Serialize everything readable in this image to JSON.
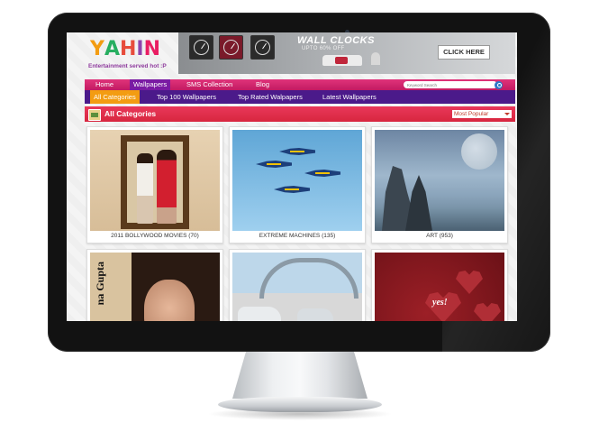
{
  "site": {
    "logo": {
      "letters": [
        "Y",
        "A",
        "H",
        "I",
        "N"
      ],
      "tagline": "Entertainment served hot :P"
    },
    "banner": {
      "title": "WALL CLOCKS",
      "subtitle": "UPTO 60% OFF",
      "cta": "CLICK HERE"
    },
    "nav_primary": [
      {
        "label": "Home"
      },
      {
        "label": "Wallpapers",
        "active": true
      },
      {
        "label": "SMS Collection"
      },
      {
        "label": "Blog"
      }
    ],
    "search": {
      "placeholder": "Keyword Search"
    },
    "nav_secondary": [
      {
        "label": "All Categories",
        "active": true
      },
      {
        "label": "Top 100 Wallpapers"
      },
      {
        "label": "Top Rated Walpapers"
      },
      {
        "label": "Latest Wallpapers"
      }
    ],
    "category_bar": {
      "title": "All Categories",
      "sort_selected": "Most Popular"
    },
    "categories": [
      {
        "caption": "2011 BOLLYWOOD MOVIES (70)"
      },
      {
        "caption": "EXTREME MACHINES (135)"
      },
      {
        "caption": "ART (953)"
      },
      {
        "caption": "",
        "overlay_text": "na Gupta"
      },
      {
        "caption": ""
      },
      {
        "caption": "",
        "overlay_text": "yes!"
      }
    ],
    "colors": {
      "nav_pink": "#d2256e",
      "nav_purple": "#4b1a8a",
      "active_orange": "#f39c12",
      "catbar_red": "#e0304e"
    }
  }
}
